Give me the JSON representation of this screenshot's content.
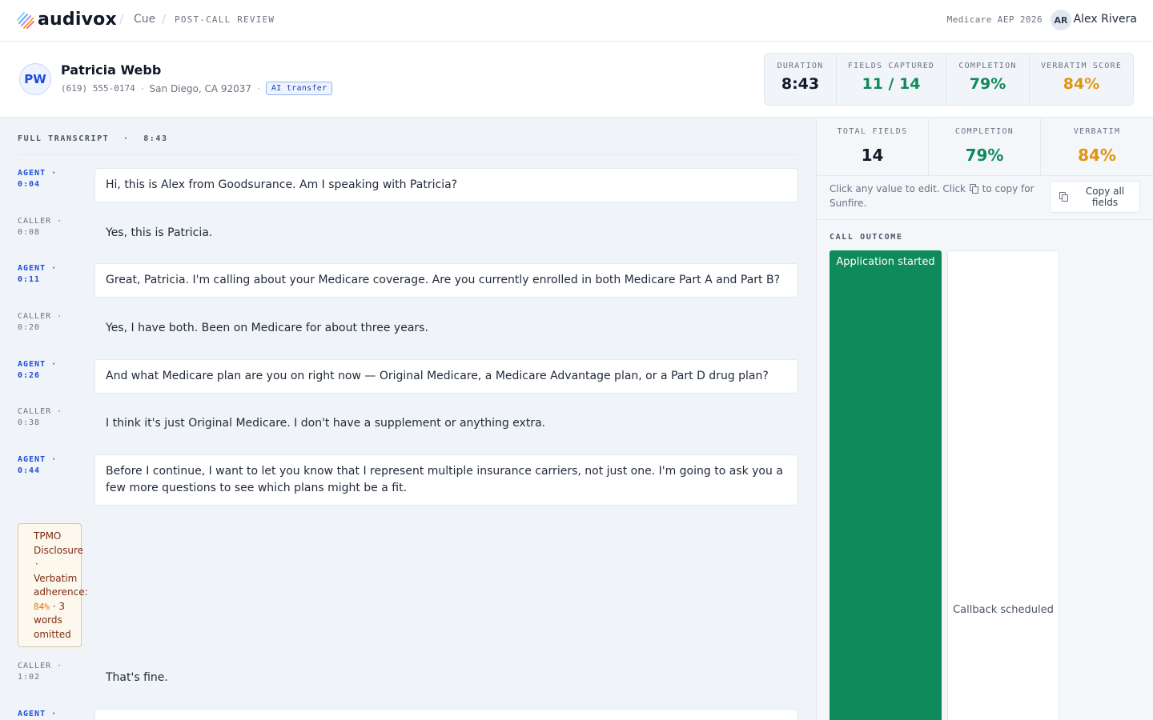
{
  "brand": {
    "name": "audivox"
  },
  "breadcrumb": {
    "product": "Cue",
    "page": "POST-CALL REVIEW"
  },
  "season": "Medicare AEP 2026",
  "user": {
    "initials": "AR",
    "name": "Alex Rivera"
  },
  "caller": {
    "initials": "PW",
    "name": "Patricia Webb",
    "phone": "(619) 555-0174",
    "location": "San Diego, CA 92037",
    "badge": "AI transfer"
  },
  "stats": [
    {
      "label": "DURATION",
      "value": "8:43",
      "color": "#111827"
    },
    {
      "label": "FIELDS CAPTURED",
      "value": "11 / 14",
      "color": "#0f8a5a"
    },
    {
      "label": "COMPLETION",
      "value": "79%",
      "color": "#0f8a5a"
    },
    {
      "label": "VERBATIM SCORE",
      "value": "84%",
      "color": "#e0950f"
    }
  ],
  "transcript": {
    "label": "FULL TRANSCRIPT",
    "duration": "8:43",
    "messages": [
      {
        "speaker": "AGENT",
        "time": "0:04",
        "text": "Hi, this is Alex from Goodsurance. Am I speaking with Patricia?"
      },
      {
        "speaker": "CALLER",
        "time": "0:08",
        "text": "Yes, this is Patricia."
      },
      {
        "speaker": "AGENT",
        "time": "0:11",
        "text": "Great, Patricia. I'm calling about your Medicare coverage. Are you currently enrolled in both Medicare Part A and Part B?"
      },
      {
        "speaker": "CALLER",
        "time": "0:20",
        "text": "Yes, I have both. Been on Medicare for about three years."
      },
      {
        "speaker": "AGENT",
        "time": "0:26",
        "text": "And what Medicare plan are you on right now — Original Medicare, a Medicare Advantage plan, or a Part D drug plan?"
      },
      {
        "speaker": "CALLER",
        "time": "0:38",
        "text": "I think it's just Original Medicare. I don't have a supplement or anything extra."
      },
      {
        "speaker": "AGENT",
        "time": "0:44",
        "text": "Before I continue, I want to let you know that I represent multiple insurance carriers, not just one. I'm going to ask you a few more questions to see which plans might be a fit."
      },
      {
        "speaker": "CALLER",
        "time": "1:02",
        "text": "That's fine."
      },
      {
        "speaker": "AGENT",
        "time": "",
        "text": ""
      }
    ],
    "tpmo": {
      "title": "TPMO",
      "title2": "Disclosure",
      "sep": "·",
      "adherence_label": "Verbatim",
      "adherence_label2": "adherence:",
      "score": "84%",
      "omitted": "3",
      "omitted_label": "words",
      "omitted_label2": "omitted"
    }
  },
  "panel": {
    "stats": [
      {
        "label": "TOTAL FIELDS",
        "value": "14",
        "color": "#111827"
      },
      {
        "label": "COMPLETION",
        "value": "79%",
        "color": "#0f8a5a"
      },
      {
        "label": "VERBATIM",
        "value": "84%",
        "color": "#e0950f"
      }
    ],
    "hint_before": "Click any value to edit. Click",
    "hint_after": "to copy for Sunfire.",
    "copy_all": "Copy all fields",
    "outcome_label": "CALL OUTCOME",
    "outcomes": [
      {
        "label": "Application started",
        "selected": true
      },
      {
        "label": "Callback scheduled",
        "selected": false
      }
    ]
  },
  "colors": {
    "accent": "#1d4ed8",
    "success": "#0f8a5a",
    "warning": "#e0950f"
  }
}
